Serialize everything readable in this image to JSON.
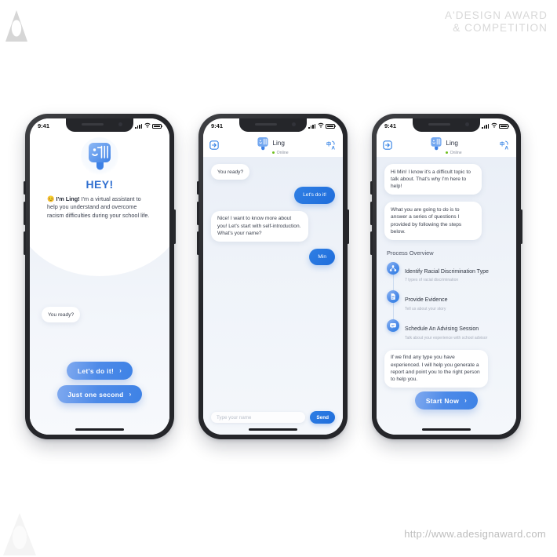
{
  "watermark": {
    "brand_line1": "A'DESIGN AWARD",
    "brand_line2": "& COMPETITION",
    "url": "http://www.adesignaward.com",
    "logo_icon": "a-triangle-logo-icon"
  },
  "screens": [
    {
      "id": "welcome",
      "statusbar": {
        "time": "9:41",
        "signal_icon": "signal-bars-icon",
        "wifi_icon": "wifi-icon",
        "battery_icon": "battery-full-icon"
      },
      "avatar_icon": "ling-avatar-logo-icon",
      "heading": "HEY!",
      "intro_emoji": "😊",
      "intro_bold": "I'm Ling!",
      "intro_text": " I'm a virtual assistant to help you understand and overcome racism difficulties during your school life.",
      "bubble": "You ready?",
      "buttons": [
        {
          "label": "Let's do it!",
          "chevron": "chevron-right-icon"
        },
        {
          "label": "Just one second",
          "chevron": "chevron-right-icon"
        }
      ]
    },
    {
      "id": "chat-name",
      "statusbar": {
        "time": "9:41"
      },
      "header": {
        "back_icon": "exit-arrow-icon",
        "avatar_icon": "ling-avatar-logo-icon",
        "name": "Ling",
        "status": "Online",
        "language_icon": "translate-language-icon"
      },
      "messages": [
        {
          "from": "bot",
          "text": "You ready?"
        },
        {
          "from": "user",
          "text": "Let's do it!"
        },
        {
          "from": "bot",
          "text": "Nice! I want to know more about you! Let's start with self-introduction. What's your name?"
        },
        {
          "from": "user",
          "text": "Min"
        }
      ],
      "composer": {
        "placeholder": "Type your name",
        "send_label": "Send"
      }
    },
    {
      "id": "chat-process",
      "statusbar": {
        "time": "9:41"
      },
      "header": {
        "back_icon": "exit-arrow-icon",
        "avatar_icon": "ling-avatar-logo-icon",
        "name": "Ling",
        "status": "Online",
        "language_icon": "translate-language-icon"
      },
      "messages": [
        {
          "from": "bot",
          "text": "Hi Min! I know it's a difficult topic to talk about. That's why I'm here to help!"
        },
        {
          "from": "bot",
          "text": "What you are going to do is to answer a series of questions I provided by following the steps below."
        }
      ],
      "process": {
        "title": "Process Overview",
        "steps": [
          {
            "title": "Identify Racial Discrimination Type",
            "subtitle": "7 types of racial discrimination",
            "icon": "hierarchy-network-icon"
          },
          {
            "title": "Provide Evidence",
            "subtitle": "Tell us about your story",
            "icon": "document-file-icon"
          },
          {
            "title": "Schedule An Advising Session",
            "subtitle": "Talk about your experience with school advisor",
            "icon": "chat-message-icon"
          }
        ]
      },
      "closing_message": "If we find any type you have experienced. I will help you generate a report and point you to the right person to help you.",
      "cta": {
        "label": "Start Now",
        "chevron": "chevron-right-icon"
      }
    }
  ],
  "colors": {
    "accent": "#2f7fe4",
    "accent_light": "#8fb6f3",
    "heading": "#2f6fd0",
    "online": "#6fbf1f",
    "frame": "#25262a",
    "chat_bg": "#eef2f8"
  }
}
